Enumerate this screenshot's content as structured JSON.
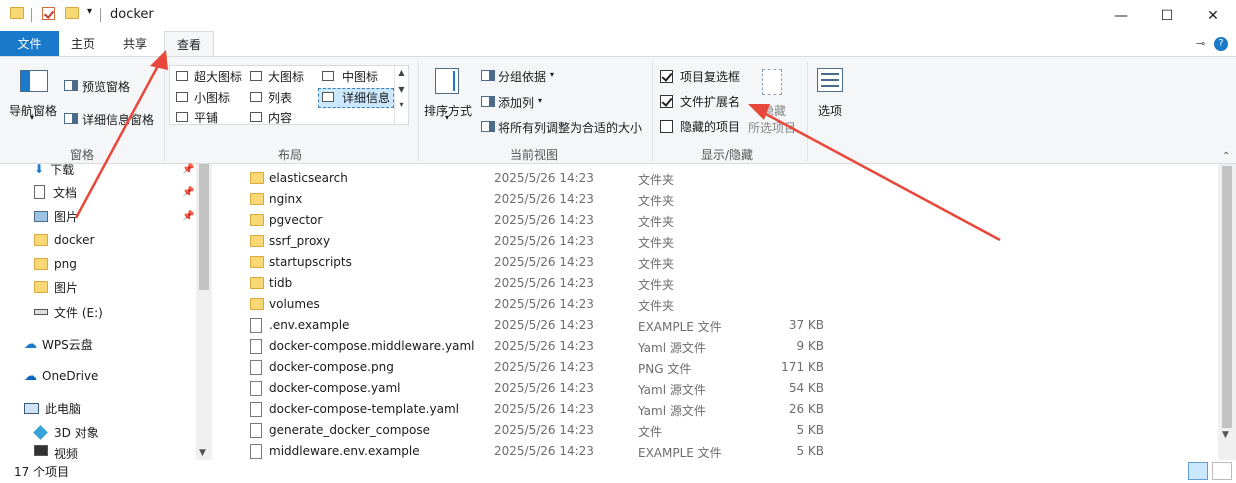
{
  "window": {
    "title": "docker",
    "minimize": "—",
    "maximize": "☐",
    "close": "✕"
  },
  "tabs": {
    "file": "文件",
    "home": "主页",
    "share": "共享",
    "view": "查看",
    "pin_icon": "⊸",
    "help": "?"
  },
  "ribbon": {
    "panes": {
      "nav_pane": "导航窗格",
      "preview_pane": "预览窗格",
      "details_pane": "详细信息窗格",
      "group_label": "窗格"
    },
    "layout": {
      "group_label": "布局",
      "items": [
        "超大图标",
        "大图标",
        "中图标",
        "小图标",
        "列表",
        "详细信息",
        "平铺",
        "内容"
      ],
      "selected": "详细信息"
    },
    "current_view": {
      "group_label": "当前视图",
      "sort_by": "排序方式",
      "group_by": "分组依据",
      "add_column": "添加列",
      "fit_columns": "将所有列调整为合适的大小"
    },
    "show_hide": {
      "group_label": "显示/隐藏",
      "item_checkboxes": "项目复选框",
      "file_extensions": "文件扩展名",
      "hidden_items": "隐藏的项目",
      "item_checkboxes_checked": true,
      "file_extensions_checked": true,
      "hidden_items_checked": false,
      "hide_selected": "隐藏",
      "hide_selected_2": "所选项目"
    },
    "options": "选项"
  },
  "nav": {
    "items": [
      {
        "label": "下载",
        "icon": "download-icon"
      },
      {
        "label": "文档",
        "icon": "document-icon"
      },
      {
        "label": "图片",
        "icon": "pictures-icon"
      },
      {
        "label": "docker",
        "icon": "folder-icon"
      },
      {
        "label": "png",
        "icon": "folder-icon"
      },
      {
        "label": "图片",
        "icon": "folder-icon"
      },
      {
        "label": "文件 (E:)",
        "icon": "drive-icon"
      },
      {
        "label": "WPS云盘",
        "icon": "cloud-icon"
      },
      {
        "label": "OneDrive",
        "icon": "onedrive-icon"
      },
      {
        "label": "此电脑",
        "icon": "computer-icon"
      },
      {
        "label": "3D 对象",
        "icon": "3d-objects-icon"
      },
      {
        "label": "视频",
        "icon": "video-icon"
      }
    ]
  },
  "files": [
    {
      "name": "elasticsearch",
      "date": "2025/5/26 14:23",
      "type": "文件夹",
      "size": "",
      "kind": "folder"
    },
    {
      "name": "nginx",
      "date": "2025/5/26 14:23",
      "type": "文件夹",
      "size": "",
      "kind": "folder"
    },
    {
      "name": "pgvector",
      "date": "2025/5/26 14:23",
      "type": "文件夹",
      "size": "",
      "kind": "folder"
    },
    {
      "name": "ssrf_proxy",
      "date": "2025/5/26 14:23",
      "type": "文件夹",
      "size": "",
      "kind": "folder"
    },
    {
      "name": "startupscripts",
      "date": "2025/5/26 14:23",
      "type": "文件夹",
      "size": "",
      "kind": "folder"
    },
    {
      "name": "tidb",
      "date": "2025/5/26 14:23",
      "type": "文件夹",
      "size": "",
      "kind": "folder"
    },
    {
      "name": "volumes",
      "date": "2025/5/26 14:23",
      "type": "文件夹",
      "size": "",
      "kind": "folder"
    },
    {
      "name": ".env.example",
      "date": "2025/5/26 14:23",
      "type": "EXAMPLE 文件",
      "size": "37 KB",
      "kind": "file"
    },
    {
      "name": "docker-compose.middleware.yaml",
      "date": "2025/5/26 14:23",
      "type": "Yaml 源文件",
      "size": "9 KB",
      "kind": "file"
    },
    {
      "name": "docker-compose.png",
      "date": "2025/5/26 14:23",
      "type": "PNG 文件",
      "size": "171 KB",
      "kind": "file"
    },
    {
      "name": "docker-compose.yaml",
      "date": "2025/5/26 14:23",
      "type": "Yaml 源文件",
      "size": "54 KB",
      "kind": "file"
    },
    {
      "name": "docker-compose-template.yaml",
      "date": "2025/5/26 14:23",
      "type": "Yaml 源文件",
      "size": "26 KB",
      "kind": "file"
    },
    {
      "name": "generate_docker_compose",
      "date": "2025/5/26 14:23",
      "type": "文件",
      "size": "5 KB",
      "kind": "file"
    },
    {
      "name": "middleware.env.example",
      "date": "2025/5/26 14:23",
      "type": "EXAMPLE 文件",
      "size": "5 KB",
      "kind": "file"
    }
  ],
  "status": {
    "item_count": "17 个项目"
  },
  "colors": {
    "accent": "#1979ca",
    "annotation": "#e8483b"
  }
}
